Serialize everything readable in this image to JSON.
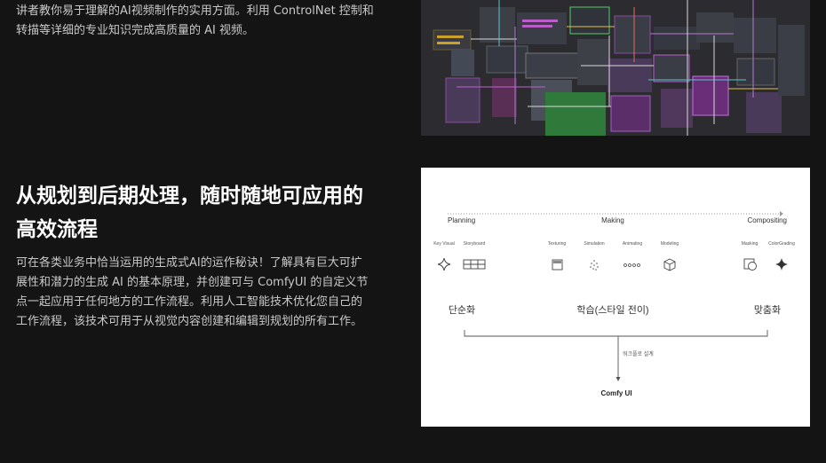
{
  "intro": {
    "line1": "讲者教你易于理解的AI视频制作的实用方面。利用 ControlNet 控制和",
    "line2": "转描等详细的专业知识完成高质量的 AI 视频。"
  },
  "section": {
    "title_line1": "从规划到后期处理，随时随地可应用的",
    "title_line2": "高效流程",
    "body_line1": "可在各类业务中恰当运用的生成式AI的运作秘诀！了解具有巨大可扩",
    "body_line2": "展性和潜力的生成 AI 的基本原理，并创建可与 ComfyUI 的自定义节",
    "body_line3": "点一起应用于任何地方的工作流程。利用人工智能技术优化您自己的",
    "body_line4": "工作流程，该技术可用于从视觉内容创建和编辑到规划的所有工作。"
  },
  "diagram": {
    "phases": [
      "Planning",
      "Making",
      "Compositing"
    ],
    "tools": [
      {
        "label": "Key Visual",
        "icon": "sparkle-outline-icon"
      },
      {
        "label": "Storyboard",
        "icon": "storyboard-grid-icon"
      },
      {
        "label": "Texturing",
        "icon": "texture-square-icon"
      },
      {
        "label": "Simulation",
        "icon": "particles-icon"
      },
      {
        "label": "Animating",
        "icon": "keyframes-icon"
      },
      {
        "label": "Modeling",
        "icon": "cube-icon"
      },
      {
        "label": "Masking",
        "icon": "mask-icon"
      },
      {
        "label": "ColorGrading",
        "icon": "sparkle-filled-icon"
      }
    ],
    "stages": [
      "단순화",
      "학습(스타일 전이)",
      "맞춤화"
    ],
    "arrow_label": "워크플로 설계",
    "target": "Comfy UI"
  }
}
